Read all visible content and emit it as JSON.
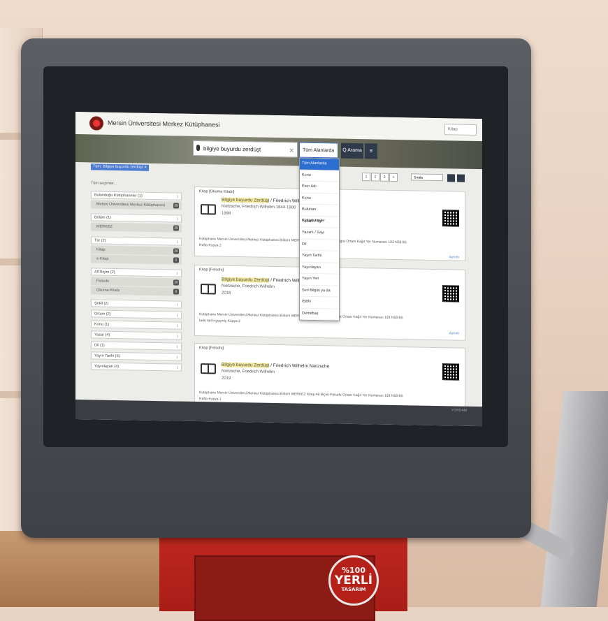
{
  "stand": {
    "stamp_line1": "%100",
    "stamp_line2": "YERLİ",
    "stamp_line3": "TASARIM"
  },
  "header": {
    "brand": "Mersin Üniversitesi Merkez Kütüphanesi",
    "lang_button": "Kitap"
  },
  "search": {
    "query": "bilgiye buyurdu zerdüşt",
    "field_selected": "Tüm Alanlarda",
    "search_button": "Q Arama",
    "menu_button": "≡",
    "options": [
      "Tüm Alanlarda",
      "Konu",
      "Eser Adı",
      "Konu",
      "Bulunan Kütüphaneler",
      "Yazarlı / İlgi",
      "Yazarlı / Sayı",
      "Dil",
      "Yayın Tarihi",
      "Yayınlayan",
      "Yayın Yeri",
      "Seri Bilgisi ya da",
      "ISBN",
      "Demirbaş"
    ]
  },
  "filters": {
    "active_chip": "Tüm: Bilgiye buyurdu zerdüşt ✕",
    "results_label": "Bulunan 28 Kayıt",
    "clear_label": "Tüm seçimler...",
    "facets": [
      {
        "label": "Bulunduğu Kütüphaneler (1)"
      },
      {
        "label": "Bölüm (1)"
      },
      {
        "label": "Tür (2)"
      },
      {
        "label": "Alt Biçim (2)"
      },
      {
        "label": "Şekil (2)"
      },
      {
        "label": "Ortam (2)"
      },
      {
        "label": "Konu (1)"
      },
      {
        "label": "Yazar (4)"
      },
      {
        "label": "Dil (1)"
      },
      {
        "label": "Yayın Tarihi (6)"
      },
      {
        "label": "Yayınlayan (4)"
      }
    ],
    "items": [
      {
        "label": "Mersin Üniversitesi Merkez Kütüphanesi",
        "count": "28"
      },
      {
        "label": "MERKEZ",
        "count": "28"
      },
      {
        "label": "Kitap",
        "count": "26"
      },
      {
        "label": "e-Kitap",
        "count": "2"
      },
      {
        "label": "Felsefe",
        "count": "20"
      },
      {
        "label": "Okuma Kitabı",
        "count": "8"
      }
    ]
  },
  "toolbar": {
    "pages": [
      "1",
      "2",
      "3",
      "»"
    ],
    "sort_label": "Sırala"
  },
  "results": [
    {
      "type": "Kitap [Okuma Kitabı]",
      "title_hl": "Bilgiye buyurdu Zerdüşt",
      "title_rest": " / Friedrich Wilhelm Nietzsche",
      "author": "Nietzsche, Friedrich Wilhelm 1844-1900",
      "year": "1998",
      "meta": "Kütüphane Mersin Üniversitesi Merkez Kütüphanesi   Bölüm MERKEZ   Okuma Kitabı   Seri Bilgisi   Ortam Kağıt   Yer Numarası 193 N58 B5",
      "meta2": "Rafta   Kopya 2",
      "link": "Ayrıntı"
    },
    {
      "type": "Kitap [Felsefe]",
      "title_hl": "Bilgiye buyurdu Zerdüşt",
      "title_rest": " / Friedrich Wilhelm Nietzsche",
      "author": "Nietzsche, Friedrich Wilhelm",
      "year": "2018",
      "meta": "Kütüphane Mersin Üniversitesi Merkez Kütüphanesi   Bölüm MERKEZ   Kitap   Alt Biçim Felsefe   Ortam Kağıt   Yer Numarası 193 N58 B5",
      "meta2": "Iade tarihi geçmiş   Kopya 2",
      "link": "Ayrıntı"
    },
    {
      "type": "Kitap [Felsefe]",
      "title_hl": "Bilgiye buyurdu Zerdüşt",
      "title_rest": " / Friedrich Wilhelm Nietzsche",
      "author": "Nietzsche, Friedrich Wilhelm",
      "year": "2019",
      "meta": "Kütüphane Mersin Üniversitesi Merkez Kütüphanesi   Bölüm MERKEZ   Kitap   Alt Biçim Felsefe   Ortam Kağıt   Yer Numarası 193 N58 B5",
      "meta2": "Rafta   Kopya 1",
      "link": ""
    }
  ],
  "footer": {
    "brand": "YORDAM"
  }
}
